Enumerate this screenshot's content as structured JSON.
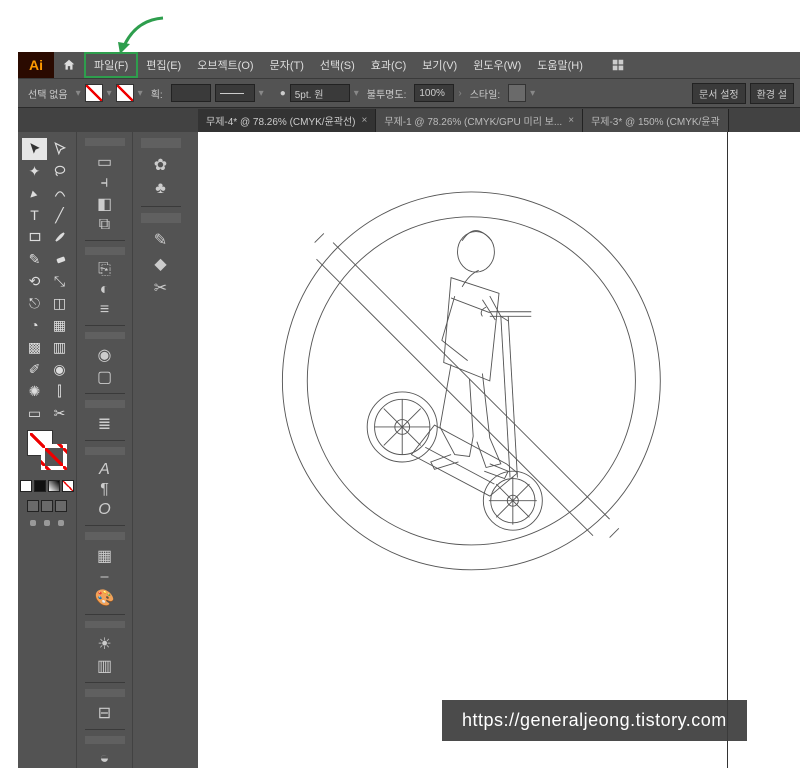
{
  "app_logo": "Ai",
  "menus": {
    "file": "파일(F)",
    "edit": "편집(E)",
    "object": "오브젝트(O)",
    "type": "문자(T)",
    "select": "선택(S)",
    "effect": "효과(C)",
    "view": "보기(V)",
    "window": "윈도우(W)",
    "help": "도움말(H)"
  },
  "options": {
    "no_selection": "선택 없음",
    "stroke_label": "획:",
    "stroke_width": "",
    "point_label": "5pt. 원",
    "opacity_label": "불투명도:",
    "opacity_value": "100%",
    "style_label": "스타일:",
    "doc_setup": "문서 설정",
    "prefs": "환경 설"
  },
  "tabs": [
    {
      "label": "무제-4* @ 78.26% (CMYK/윤곽선)",
      "active": true
    },
    {
      "label": "무제-1 @ 78.26% (CMYK/GPU 미리 보...",
      "active": false
    },
    {
      "label": "무제-3* @ 150% (CMYK/윤곽",
      "active": false
    }
  ],
  "watermark": "https://generaljeong.tistory.com",
  "annotation": {
    "highlight": "file-menu",
    "arrow_color": "#2e9e4d"
  }
}
